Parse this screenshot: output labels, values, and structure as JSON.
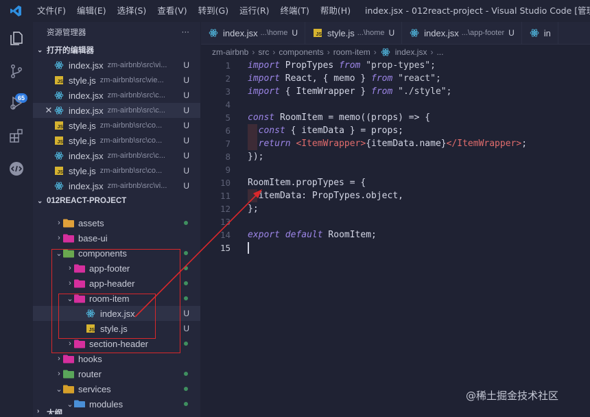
{
  "titlebar": {
    "menu": [
      "文件(F)",
      "编辑(E)",
      "选择(S)",
      "查看(V)",
      "转到(G)",
      "运行(R)",
      "终端(T)",
      "帮助(H)"
    ],
    "title": "index.jsx - 012react-project - Visual Studio Code [管理员]"
  },
  "activity": {
    "icons": [
      "explorer-icon",
      "source-control-icon",
      "run-debug-icon",
      "extensions-icon",
      "remote-icon"
    ],
    "scm_badge": "65"
  },
  "sidebar": {
    "header": "资源管理器",
    "more": "···",
    "open_editors_title": "打开的编辑器",
    "open_editors": [
      {
        "name": "index.jsx",
        "path": "zm-airbnb\\src\\vi...",
        "type": "react",
        "flag": "U",
        "close": false
      },
      {
        "name": "style.js",
        "path": "zm-airbnb\\src\\vie...",
        "type": "js",
        "flag": "U",
        "close": false
      },
      {
        "name": "index.jsx",
        "path": "zm-airbnb\\src\\c...",
        "type": "react",
        "flag": "U",
        "close": false
      },
      {
        "name": "index.jsx",
        "path": "zm-airbnb\\src\\c...",
        "type": "react",
        "flag": "U",
        "close": true
      },
      {
        "name": "style.js",
        "path": "zm-airbnb\\src\\co...",
        "type": "js",
        "flag": "U",
        "close": false
      },
      {
        "name": "style.js",
        "path": "zm-airbnb\\src\\co...",
        "type": "js",
        "flag": "U",
        "close": false
      },
      {
        "name": "index.jsx",
        "path": "zm-airbnb\\src\\c...",
        "type": "react",
        "flag": "U",
        "close": false
      },
      {
        "name": "style.js",
        "path": "zm-airbnb\\src\\co...",
        "type": "js",
        "flag": "U",
        "close": false
      },
      {
        "name": "index.jsx",
        "path": "zm-airbnb\\src\\vi...",
        "type": "react",
        "flag": "U",
        "close": false
      }
    ],
    "project_title": "012REACT-PROJECT",
    "tree": [
      {
        "name": "assets",
        "indent": 1,
        "twisty": "›",
        "icon": "folder-assets",
        "mark": "dot"
      },
      {
        "name": "base-ui",
        "indent": 1,
        "twisty": "›",
        "icon": "folder-pink",
        "mark": ""
      },
      {
        "name": "components",
        "indent": 1,
        "twisty": "⌄",
        "icon": "folder-components",
        "mark": "dot"
      },
      {
        "name": "app-footer",
        "indent": 2,
        "twisty": "›",
        "icon": "folder-pink",
        "mark": "dot"
      },
      {
        "name": "app-header",
        "indent": 2,
        "twisty": "›",
        "icon": "folder-pink",
        "mark": "dot"
      },
      {
        "name": "room-item",
        "indent": 2,
        "twisty": "⌄",
        "icon": "folder-pink-open",
        "mark": "dot"
      },
      {
        "name": "index.jsx",
        "indent": 3,
        "twisty": "",
        "icon": "react",
        "mark": "U"
      },
      {
        "name": "style.js",
        "indent": 3,
        "twisty": "",
        "icon": "js",
        "mark": "U"
      },
      {
        "name": "section-header",
        "indent": 2,
        "twisty": "›",
        "icon": "folder-pink",
        "mark": "dot"
      },
      {
        "name": "hooks",
        "indent": 1,
        "twisty": "›",
        "icon": "folder-pink",
        "mark": ""
      },
      {
        "name": "router",
        "indent": 1,
        "twisty": "›",
        "icon": "folder-router",
        "mark": "dot"
      },
      {
        "name": "services",
        "indent": 1,
        "twisty": "⌄",
        "icon": "folder-services",
        "mark": "dot"
      },
      {
        "name": "modules",
        "indent": 2,
        "twisty": "⌄",
        "icon": "folder-modules",
        "mark": "dot"
      }
    ],
    "outline_title": "大纲"
  },
  "editor": {
    "tabs": [
      {
        "name": "index.jsx",
        "path": "...\\home",
        "type": "react",
        "flag": "U"
      },
      {
        "name": "style.js",
        "path": "...\\home",
        "type": "js",
        "flag": "U"
      },
      {
        "name": "index.jsx",
        "path": "...\\app-footer",
        "type": "react",
        "flag": "U"
      },
      {
        "name": "in",
        "path": "",
        "type": "react",
        "flag": ""
      }
    ],
    "breadcrumb": [
      "zm-airbnb",
      "src",
      "components",
      "room-item",
      "index.jsx",
      "..."
    ],
    "lines": [
      [
        [
          "kw",
          "import"
        ],
        [
          "id",
          " PropTypes "
        ],
        [
          "kw",
          "from"
        ],
        [
          "str",
          " \"prop-types\";"
        ]
      ],
      [
        [
          "kw",
          "import"
        ],
        [
          "id",
          " React, { memo } "
        ],
        [
          "kw",
          "from"
        ],
        [
          "str",
          " \"react\";"
        ]
      ],
      [
        [
          "kw",
          "import"
        ],
        [
          "id",
          " { ItemWrapper } "
        ],
        [
          "kw",
          "from"
        ],
        [
          "str",
          " \"./style\";"
        ]
      ],
      [],
      [
        [
          "kw",
          "const"
        ],
        [
          "id",
          " RoomItem = memo((props) => {"
        ]
      ],
      [
        [
          "id",
          "  "
        ],
        [
          "kw",
          "const"
        ],
        [
          "id",
          " { itemData } = props;"
        ]
      ],
      [
        [
          "id",
          "  "
        ],
        [
          "kw",
          "return"
        ],
        [
          "id",
          " "
        ],
        [
          "tag",
          "<ItemWrapper>"
        ],
        [
          "id",
          "{itemData.name}"
        ],
        [
          "tag",
          "</ItemWrapper>"
        ],
        [
          "id",
          ";"
        ]
      ],
      [
        [
          "id",
          "});"
        ]
      ],
      [],
      [
        [
          "id",
          "RoomItem.propTypes = {"
        ]
      ],
      [
        [
          "id",
          "  itemData: PropTypes.object,"
        ]
      ],
      [
        [
          "id",
          "};"
        ]
      ],
      [],
      [
        [
          "kw",
          "export"
        ],
        [
          "id",
          " "
        ],
        [
          "kw",
          "default"
        ],
        [
          "id",
          " RoomItem;"
        ]
      ],
      []
    ]
  },
  "watermark": "@稀土掘金技术社区",
  "colors": {
    "accent": "#2f7be0",
    "annotation": "#d9282b",
    "react_icon": "#4fb3d9",
    "js_icon": "#d6b330",
    "folder_pink": "#d62f9d"
  }
}
